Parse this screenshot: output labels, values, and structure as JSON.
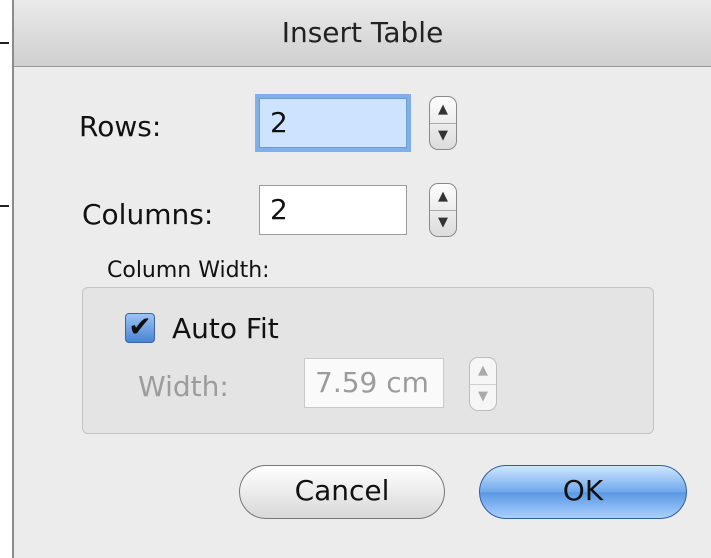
{
  "dialog": {
    "title": "Insert Table"
  },
  "rows": {
    "label": "Rows:",
    "value": "2"
  },
  "columns": {
    "label": "Columns:",
    "value": "2"
  },
  "column_width": {
    "group_label": "Column Width:",
    "auto_fit_label": "Auto Fit",
    "auto_fit_checked": true,
    "check_glyph": "✔",
    "width_label": "Width:",
    "width_value": "7.59 cm"
  },
  "buttons": {
    "cancel_label": "Cancel",
    "ok_label": "OK"
  },
  "icons": {
    "arrow_up": "▲",
    "arrow_down": "▼"
  }
}
